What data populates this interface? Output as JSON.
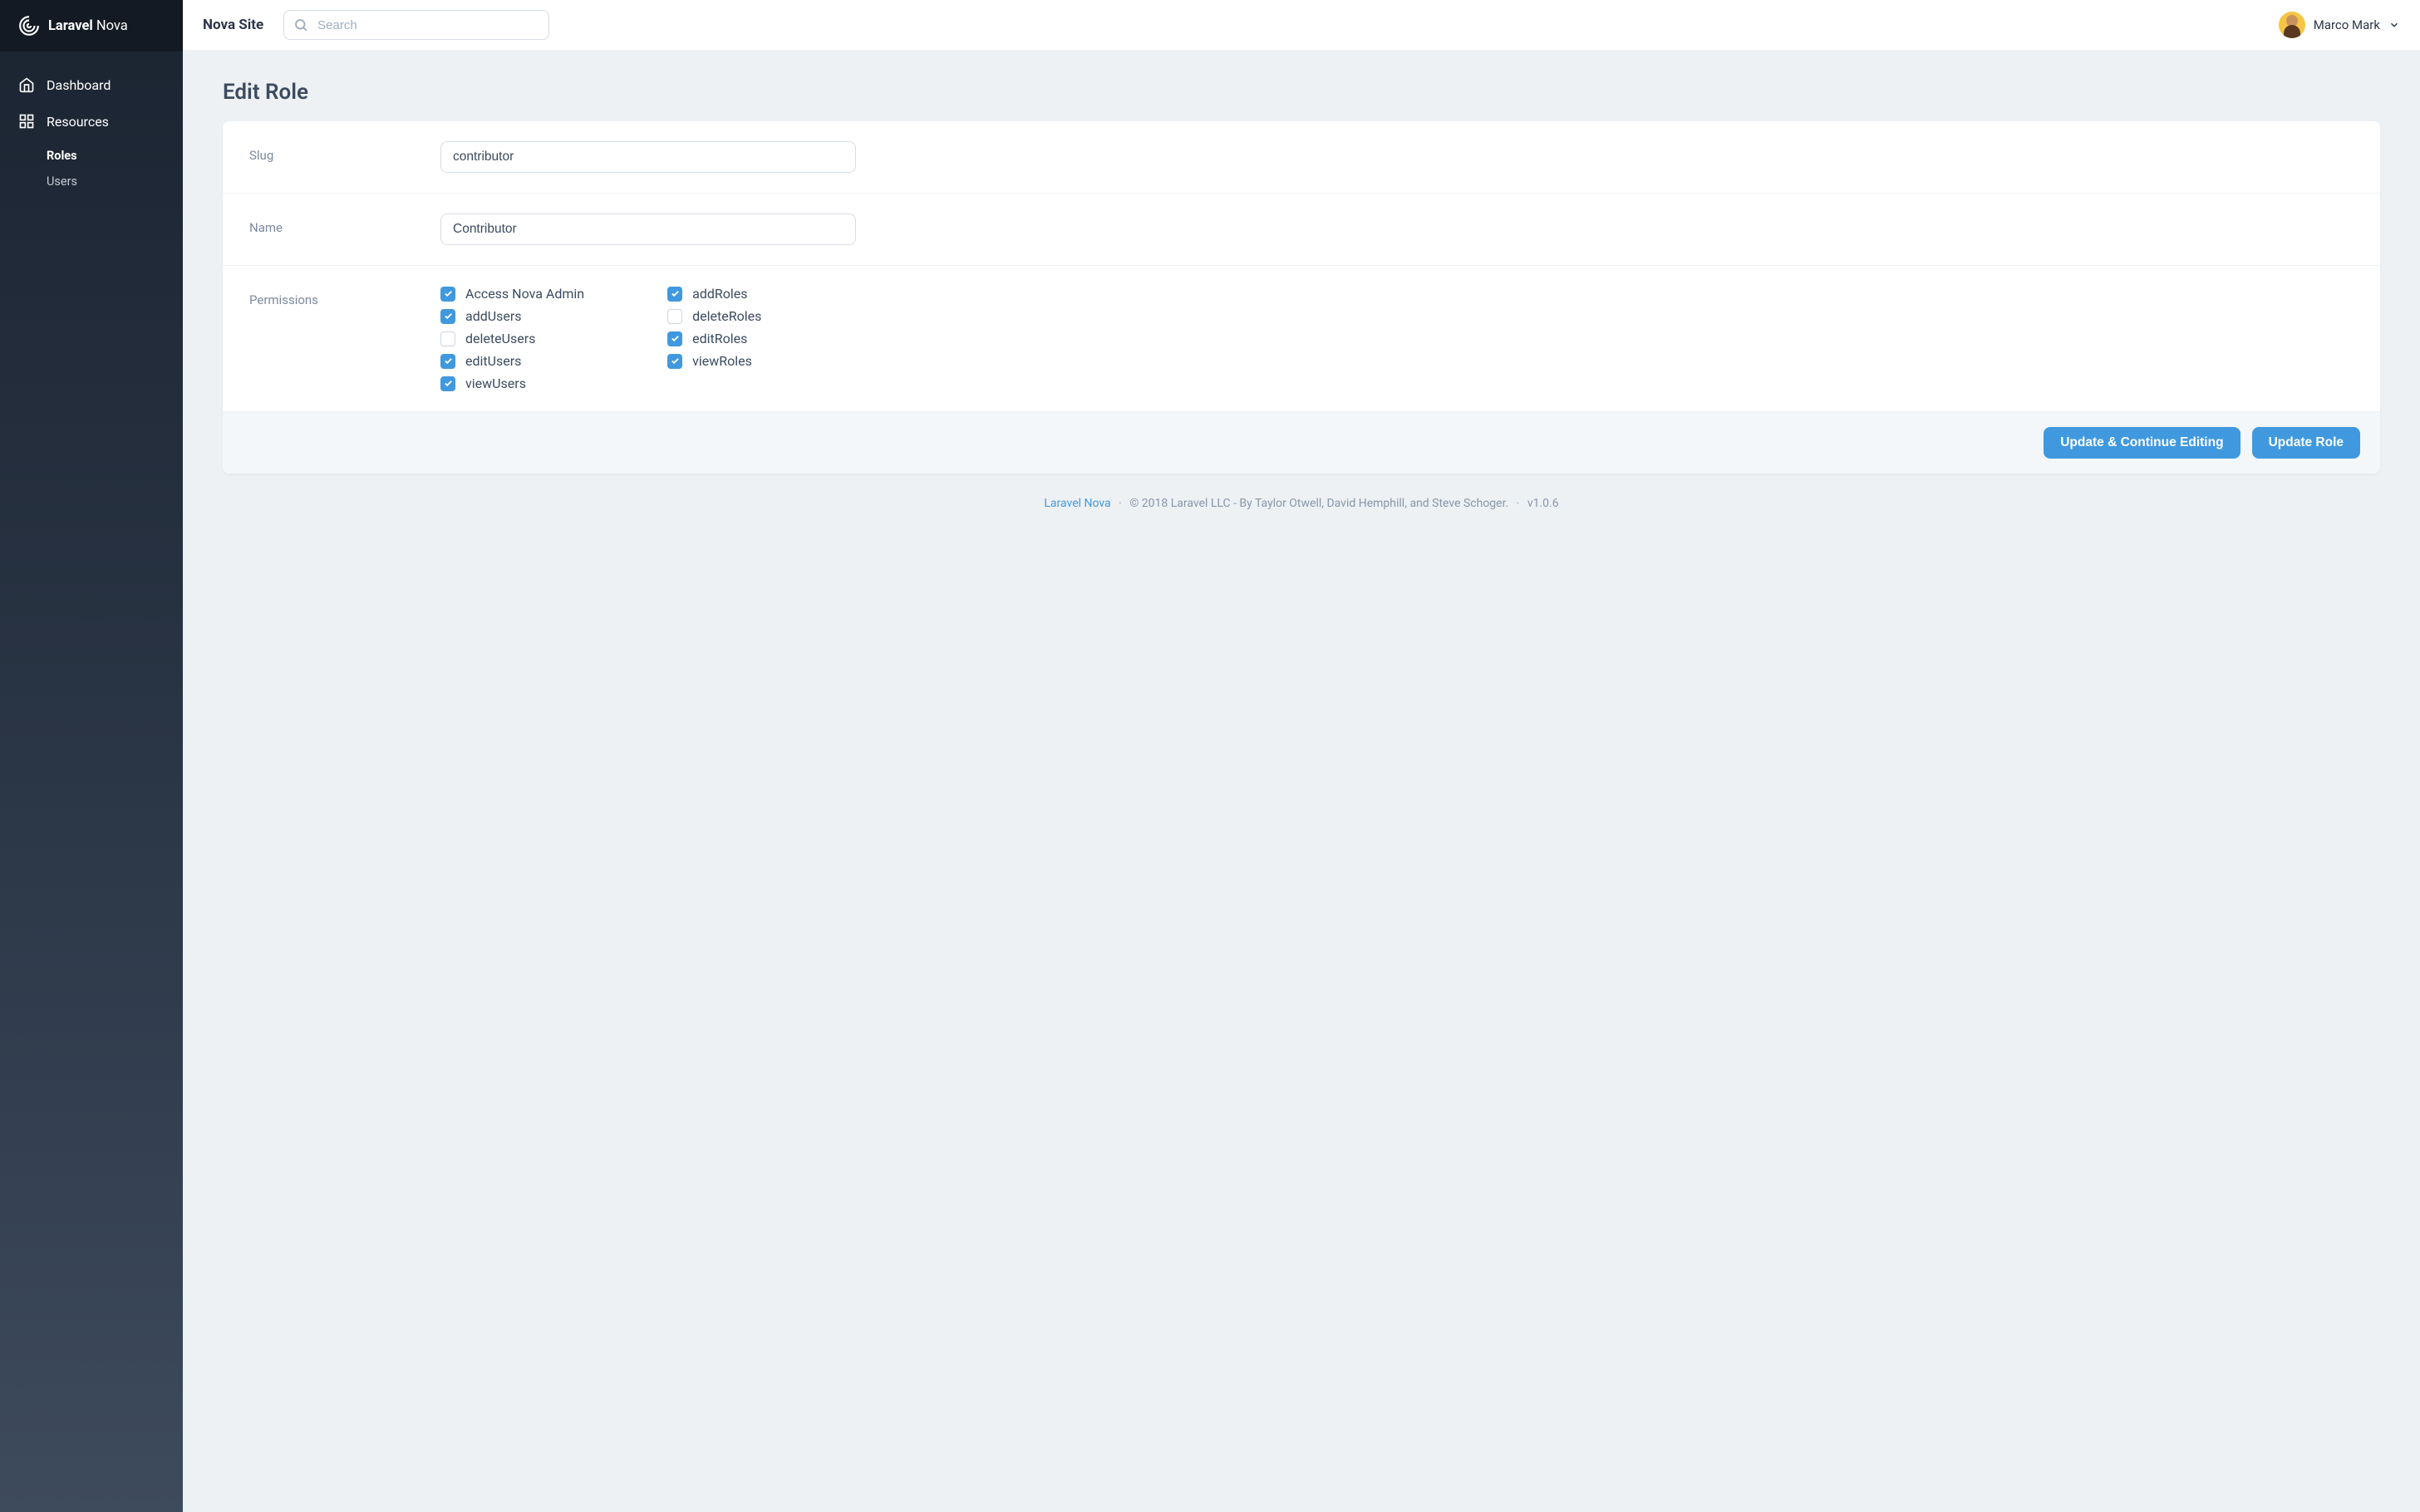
{
  "app": {
    "name_bold": "Laravel",
    "name_light": "Nova"
  },
  "sidebar": {
    "dashboard": "Dashboard",
    "resources": "Resources",
    "items": [
      {
        "label": "Roles",
        "active": true
      },
      {
        "label": "Users",
        "active": false
      }
    ]
  },
  "topbar": {
    "site_name": "Nova Site",
    "search_placeholder": "Search",
    "user_name": "Marco Mark"
  },
  "page": {
    "title": "Edit Role",
    "fields": {
      "slug_label": "Slug",
      "slug_value": "contributor",
      "name_label": "Name",
      "name_value": "Contributor",
      "permissions_label": "Permissions"
    },
    "permissions": {
      "col1": [
        {
          "label": "Access Nova Admin",
          "checked": true
        },
        {
          "label": "addUsers",
          "checked": true
        },
        {
          "label": "deleteUsers",
          "checked": false
        },
        {
          "label": "editUsers",
          "checked": true
        },
        {
          "label": "viewUsers",
          "checked": true
        }
      ],
      "col2": [
        {
          "label": "addRoles",
          "checked": true
        },
        {
          "label": "deleteRoles",
          "checked": false
        },
        {
          "label": "editRoles",
          "checked": true
        },
        {
          "label": "viewRoles",
          "checked": true
        }
      ]
    },
    "actions": {
      "update_continue": "Update & Continue Editing",
      "update": "Update Role"
    }
  },
  "footer": {
    "link_text": "Laravel Nova",
    "copyright": "© 2018 Laravel LLC - By Taylor Otwell, David Hemphill, and Steve Schoger.",
    "version": "v1.0.6"
  }
}
